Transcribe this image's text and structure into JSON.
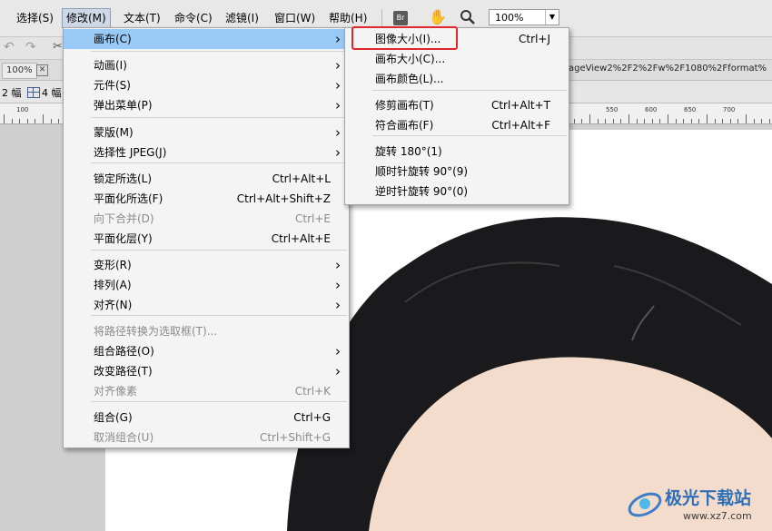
{
  "menubar": {
    "items": [
      "选择(S)",
      "修改(M)",
      "文本(T)",
      "命令(C)",
      "滤镜(I)",
      "窗口(W)",
      "帮助(H)"
    ],
    "badge": "Br",
    "zoom": "100%"
  },
  "toolbar": {
    "zoom_tab": "100%"
  },
  "doc_tab": {
    "url_fragment": "ageView2%2F2%2Fw%2F1080%2Fformat%"
  },
  "view_bar": {
    "frames_left": "2 幅",
    "frames_right": "4 幅"
  },
  "ruler": {
    "labels": [
      "100",
      "550",
      "600",
      "650",
      "700"
    ]
  },
  "modify_menu": {
    "items": [
      {
        "label": "画布(C)",
        "shortcut": "",
        "submenu": true,
        "state": "highlighted"
      },
      {
        "label": "动画(I)",
        "shortcut": "",
        "submenu": true,
        "state": "normal"
      },
      {
        "label": "元件(S)",
        "shortcut": "",
        "submenu": true,
        "state": "normal"
      },
      {
        "label": "弹出菜单(P)",
        "shortcut": "",
        "submenu": true,
        "state": "normal"
      },
      {
        "label": "蒙版(M)",
        "shortcut": "",
        "submenu": true,
        "state": "normal"
      },
      {
        "label": "选择性 JPEG(J)",
        "shortcut": "",
        "submenu": true,
        "state": "normal"
      },
      {
        "label": "锁定所选(L)",
        "shortcut": "Ctrl+Alt+L",
        "submenu": false,
        "state": "normal"
      },
      {
        "label": "平面化所选(F)",
        "shortcut": "Ctrl+Alt+Shift+Z",
        "submenu": false,
        "state": "normal"
      },
      {
        "label": "向下合并(D)",
        "shortcut": "Ctrl+E",
        "submenu": false,
        "state": "disabled"
      },
      {
        "label": "平面化层(Y)",
        "shortcut": "Ctrl+Alt+E",
        "submenu": false,
        "state": "normal"
      },
      {
        "label": "变形(R)",
        "shortcut": "",
        "submenu": true,
        "state": "normal"
      },
      {
        "label": "排列(A)",
        "shortcut": "",
        "submenu": true,
        "state": "normal"
      },
      {
        "label": "对齐(N)",
        "shortcut": "",
        "submenu": true,
        "state": "normal"
      },
      {
        "label": "将路径转换为选取框(T)...",
        "shortcut": "",
        "submenu": false,
        "state": "disabled"
      },
      {
        "label": "组合路径(O)",
        "shortcut": "",
        "submenu": true,
        "state": "normal"
      },
      {
        "label": "改变路径(T)",
        "shortcut": "",
        "submenu": true,
        "state": "normal"
      },
      {
        "label": "对齐像素",
        "shortcut": "Ctrl+K",
        "submenu": false,
        "state": "disabled"
      },
      {
        "label": "组合(G)",
        "shortcut": "Ctrl+G",
        "submenu": false,
        "state": "normal"
      },
      {
        "label": "取消组合(U)",
        "shortcut": "Ctrl+Shift+G",
        "submenu": false,
        "state": "disabled"
      }
    ]
  },
  "canvas_submenu": {
    "items": [
      {
        "label": "图像大小(I)...",
        "shortcut": "Ctrl+J"
      },
      {
        "label": "画布大小(C)...",
        "shortcut": ""
      },
      {
        "label": "画布颜色(L)...",
        "shortcut": ""
      },
      {
        "label": "修剪画布(T)",
        "shortcut": "Ctrl+Alt+T"
      },
      {
        "label": "符合画布(F)",
        "shortcut": "Ctrl+Alt+F"
      },
      {
        "label": "旋转 180°(1)",
        "shortcut": ""
      },
      {
        "label": "顺时针旋转 90°(9)",
        "shortcut": ""
      },
      {
        "label": "逆时针旋转 90°(0)",
        "shortcut": ""
      }
    ]
  },
  "watermark": {
    "title": "极光下载站",
    "url": "www.xz7.com"
  },
  "colors": {
    "highlight": "#99c9f5",
    "annotation": "#e0282c"
  }
}
